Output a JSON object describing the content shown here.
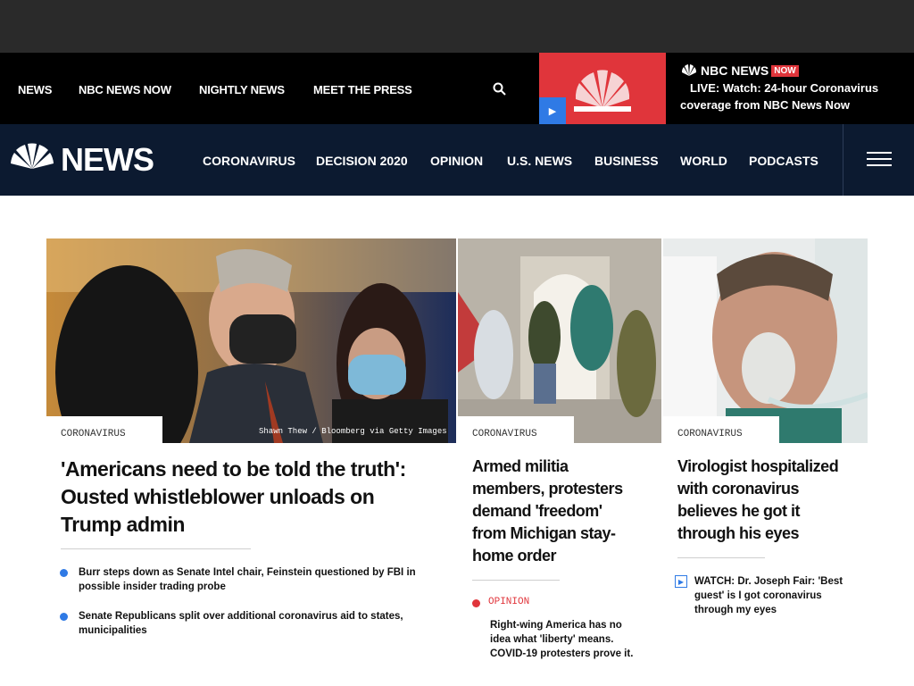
{
  "subnav": {
    "items": [
      "NEWS",
      "NBC NEWS NOW",
      "NIGHTLY NEWS",
      "MEET THE PRESS"
    ]
  },
  "live": {
    "brand": "NBC NEWS",
    "now": "NOW",
    "line1": "LIVE: Watch: 24-hour Coronavirus",
    "line2": "coverage from NBC News Now"
  },
  "mainnav": {
    "logo_text": "NEWS",
    "items": [
      "CORONAVIRUS",
      "DECISION 2020",
      "OPINION",
      "U.S. NEWS",
      "BUSINESS",
      "WORLD",
      "PODCASTS"
    ]
  },
  "lead": {
    "tag": "CORONAVIRUS",
    "credit": "Shawn Thew / Bloomberg via Getty Images",
    "headline_l1": "'Americans need to be told the truth':",
    "headline_l2": "Ousted whistleblower unloads on",
    "headline_l3": "Trump admin",
    "related": [
      {
        "l1": "Burr steps down as Senate Intel chair, Feinstein questioned by FBI in",
        "l2": "possible insider trading probe"
      },
      {
        "l1": "Senate Republicans split over additional coronavirus aid to states,",
        "l2": "municipalities"
      }
    ]
  },
  "second": {
    "tag": "CORONAVIRUS",
    "headline": [
      "Armed militia",
      "members, protesters",
      "demand 'freedom'",
      "from Michigan stay-",
      "home order"
    ],
    "opinion_tag": "OPINION",
    "related": [
      "Right-wing America has no",
      "idea what 'liberty' means.",
      "COVID-19 protesters prove it."
    ]
  },
  "third": {
    "tag": "CORONAVIRUS",
    "headline": [
      "Virologist hospitalized",
      "with coronavirus",
      "believes he got it",
      "through his eyes"
    ],
    "related": [
      "WATCH: Dr. Joseph Fair: 'Best",
      "guest' is I got coronavirus",
      "through my eyes"
    ]
  },
  "colors": {
    "nav_bg": "#0c1a30",
    "accent_red": "#e0353b",
    "accent_blue": "#2f7ae5"
  }
}
